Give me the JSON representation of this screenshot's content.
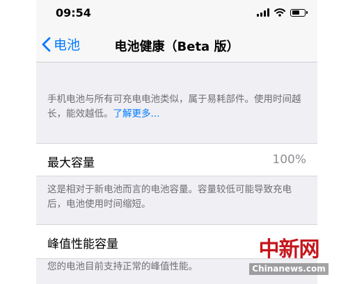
{
  "status_bar": {
    "time": "09:54",
    "icons": [
      "signal-icon",
      "wifi-icon",
      "battery-icon"
    ]
  },
  "nav": {
    "back_label": "电池",
    "title": "电池健康（Beta 版）"
  },
  "intro": {
    "text": "手机电池与所有可充电电池类似，属于易耗部件。使用时间越长，能效越低。",
    "link": "了解更多..."
  },
  "max_capacity": {
    "label": "最大容量",
    "value": "100%",
    "description": "这是相对于新电池而言的电池容量。容量较低可能导致充电后，电池使用时间缩短。"
  },
  "peak_performance": {
    "label": "峰值性能容量",
    "description": "您的电池目前支持正常的峰值性能。"
  },
  "watermark": {
    "logo": "中新网",
    "site": "Chinanews.com"
  },
  "colors": {
    "accent": "#007aff",
    "secondary_text": "#6d6d72",
    "value_text": "#8e8e93",
    "background": "#efeff4",
    "watermark_red": "#c4161c"
  }
}
